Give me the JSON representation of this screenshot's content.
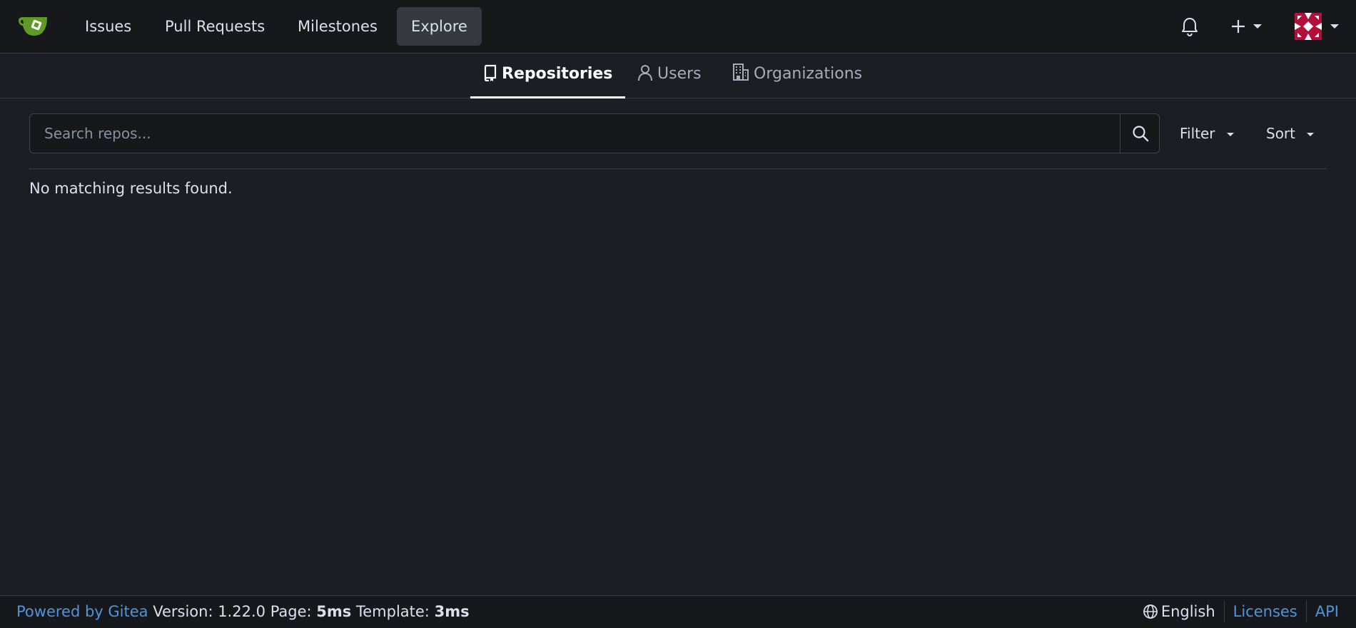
{
  "nav": {
    "items": [
      {
        "label": "Issues"
      },
      {
        "label": "Pull Requests"
      },
      {
        "label": "Milestones"
      },
      {
        "label": "Explore",
        "active": true
      }
    ]
  },
  "tabs": [
    {
      "label": "Repositories",
      "icon": "repo-icon",
      "active": true
    },
    {
      "label": "Users",
      "icon": "user-icon"
    },
    {
      "label": "Organizations",
      "icon": "organization-icon"
    }
  ],
  "search": {
    "placeholder": "Search repos...",
    "value": ""
  },
  "filter_label": "Filter",
  "sort_label": "Sort",
  "empty_message": "No matching results found.",
  "footer": {
    "powered_by": "Powered by Gitea",
    "version": "Version: 1.22.0",
    "page_label": "Page:",
    "page_time": "5ms",
    "template_label": "Template:",
    "template_time": "3ms",
    "language": "English",
    "licenses": "Licenses",
    "api": "API"
  },
  "colors": {
    "background": "#1c1e23",
    "navbar": "#16181c",
    "link": "#4f94dc",
    "logo": "#609926"
  }
}
